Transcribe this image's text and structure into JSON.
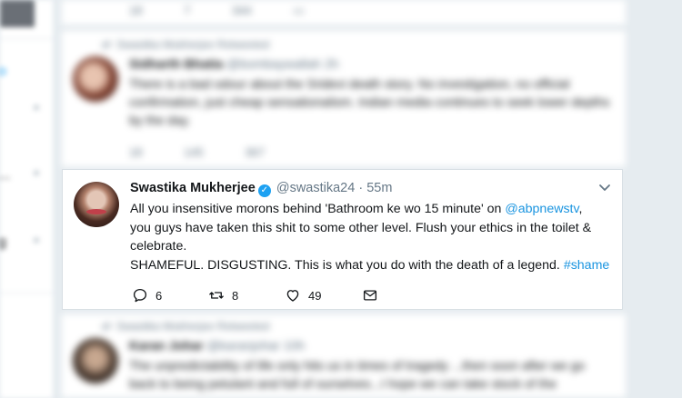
{
  "left_column": {
    "letters": [
      "o",
      "",
      "...",
      "g"
    ]
  },
  "blurred_top": {
    "actions": {
      "reply": "18",
      "retweet": "7",
      "like": "344"
    }
  },
  "blurred_tweet_1": {
    "context": "Swastika Mukherjee Retweeted",
    "name": "Sidharth Bhatia",
    "handle": "@bombaywallah",
    "time": "2h",
    "text": "There is a bad odour about the Sridevi death story. No investigation, no official confirmation, just cheap sensationalism. Indian media continues to seek lower depths by the day.",
    "actions": {
      "reply": "18",
      "retweet": "145",
      "like": "367"
    }
  },
  "main_tweet": {
    "name": "Swastika Mukherjee",
    "handle": "@swastika24",
    "separator": "·",
    "time": "55m",
    "line1_pre": "All you insensitive morons behind 'Bathroom ke wo 15 minute' on ",
    "mention": "@abpnewstv",
    "line1_post": ",",
    "line2": "you guys have taken this shit to some other level. Flush your ethics in the toilet &",
    "line3": "celebrate.",
    "line4_pre": "SHAMEFUL. DISGUSTING. This is what you do with the death of a legend. ",
    "hashtag": "#shame",
    "actions": {
      "reply": "6",
      "retweet": "8",
      "like": "49"
    }
  },
  "blurred_tweet_2": {
    "context": "Swastika Mukherjee Retweeted",
    "name": "Karan Johar",
    "handle": "@karanjohar",
    "time": "10h",
    "text": "The unpredictability of life only hits us in times of tragedy ...then soon after we go back to being petulant and full of ourselves...I hope we can take stock of the"
  },
  "colors": {
    "link": "#1b95e0",
    "verified": "#1da1f2",
    "muted": "#657786",
    "background": "#e6ecf0"
  }
}
